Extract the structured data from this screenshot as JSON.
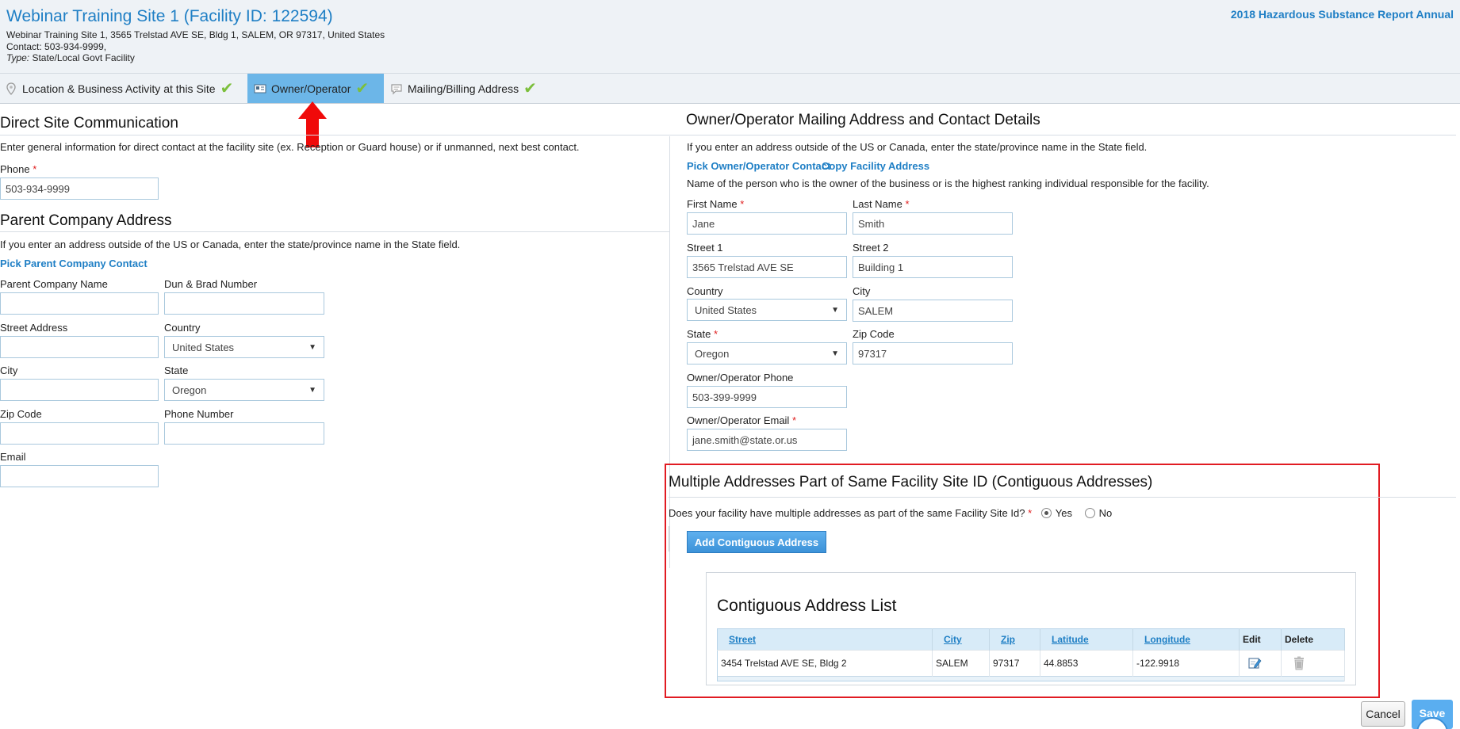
{
  "header": {
    "title": "Webinar Training Site 1 (Facility ID: 122594)",
    "address_line": "Webinar Training Site 1, 3565 Trelstad AVE SE, Bldg 1, SALEM, OR 97317, United States",
    "contact_line": "Contact: 503-934-9999,",
    "type_label": "Type:",
    "type_value": "State/Local Govt Facility",
    "report_title": "2018 Hazardous Substance Report Annual"
  },
  "tabs": [
    {
      "label": "Location & Business Activity at this Site",
      "icon": "location-pin-icon",
      "complete": true
    },
    {
      "label": "Owner/Operator",
      "icon": "id-card-icon",
      "complete": true,
      "active": true
    },
    {
      "label": "Mailing/Billing Address",
      "icon": "chat-bubble-icon",
      "complete": true
    }
  ],
  "direct": {
    "title": "Direct Site Communication",
    "note": "Enter general information for direct contact at the facility site (ex. Reception or Guard house) or if unmanned, next best contact.",
    "phone_label": "Phone",
    "phone_value": "503-934-9999"
  },
  "parent": {
    "title": "Parent Company Address",
    "note": "If you enter an address outside of the US or Canada, enter the state/province name in the State field.",
    "pick_link": "Pick Parent Company Contact",
    "name_label": "Parent Company Name",
    "dun_label": "Dun & Brad Number",
    "street_label": "Street Address",
    "country_label": "Country",
    "country_value": "United States",
    "city_label": "City",
    "state_label": "State",
    "state_value": "Oregon",
    "zip_label": "Zip Code",
    "phone_label": "Phone Number",
    "email_label": "Email"
  },
  "owner": {
    "title": "Owner/Operator Mailing Address and Contact Details",
    "note": "If you enter an address outside of the US or Canada, enter the state/province name in the State field.",
    "pick_link": "Pick Owner/Operator Contact",
    "copy_link": "Copy Facility Address",
    "desc": "Name of the person who is the owner of the business or is the highest ranking individual responsible for the facility.",
    "first_label": "First Name",
    "first_value": "Jane",
    "last_label": "Last Name",
    "last_value": "Smith",
    "street1_label": "Street 1",
    "street1_value": "3565 Trelstad AVE SE",
    "street2_label": "Street 2",
    "street2_value": "Building 1",
    "country_label": "Country",
    "country_value": "United States",
    "city_label": "City",
    "city_value": "SALEM",
    "state_label": "State",
    "state_value": "Oregon",
    "zip_label": "Zip Code",
    "zip_value": "97317",
    "phone_label": "Owner/Operator Phone",
    "phone_value": "503-399-9999",
    "email_label": "Owner/Operator Email",
    "email_value": "jane.smith@state.or.us"
  },
  "contiguous": {
    "title": "Multiple Addresses Part of Same Facility Site ID (Contiguous Addresses)",
    "question": "Does your facility have multiple addresses as part of the same Facility Site Id?",
    "yes_label": "Yes",
    "no_label": "No",
    "selected": "Yes",
    "add_button": "Add Contiguous Address",
    "list_title": "Contiguous Address List",
    "columns": [
      "Street",
      "City",
      "Zip",
      "Latitude",
      "Longitude",
      "Edit",
      "Delete"
    ],
    "rows": [
      {
        "street": "3454 Trelstad AVE SE, Bldg 2",
        "city": "SALEM",
        "zip": "97317",
        "latitude": "44.8853",
        "longitude": "-122.9918"
      }
    ]
  },
  "actions": {
    "cancel": "Cancel",
    "save": "Save"
  },
  "colors": {
    "accent": "#1f7fc5",
    "active_tab": "#6cb6e8",
    "check": "#7cbf3c",
    "highlight_box": "#e11b22",
    "required": "#e02020"
  }
}
